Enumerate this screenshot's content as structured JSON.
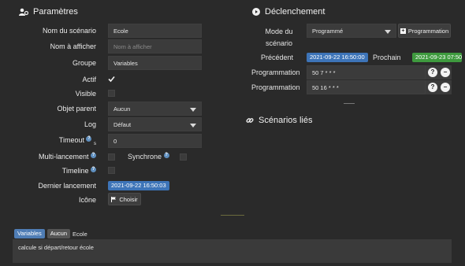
{
  "parametres": {
    "title": "Paramètres",
    "labels": {
      "nom_scenario": "Nom du scénario",
      "nom_afficher": "Nom à afficher",
      "groupe": "Groupe",
      "actif": "Actif",
      "visible": "Visible",
      "objet_parent": "Objet parent",
      "log": "Log",
      "timeout": "Timeout",
      "timeout_suffix": "s",
      "multi_lancement": "Multi-lancement",
      "synchrone": "Synchrone",
      "timeline": "Timeline",
      "dernier_lancement": "Dernier lancement",
      "icone": "Icône"
    },
    "values": {
      "nom_scenario": "Ecole",
      "nom_afficher_placeholder": "Nom à afficher",
      "groupe": "Variables",
      "objet_parent": "Aucun",
      "log": "Défaut",
      "timeout": "0",
      "dernier_lancement": "2021-09-22 16:50:03",
      "choisir": "Choisir"
    },
    "actif_checked": true,
    "visible_checked": false,
    "multi_lancement_checked": false,
    "synchrone_checked": false,
    "timeline_checked": false
  },
  "declenchement": {
    "title": "Déclenchement",
    "mode_label_1": "Mode du",
    "mode_label_2": "scénario",
    "mode_value": "Programmé",
    "programmation_button": "Programmation",
    "precedent_label": "Précédent",
    "precedent_value": "2021-09-22 16:50:00",
    "prochain_label": "Prochain",
    "prochain_value": "2021-09-23 07:50",
    "programmations": [
      {
        "label": "Programmation",
        "value": "50 7 * * *"
      },
      {
        "label": "Programmation",
        "value": "50 16 * * *"
      }
    ]
  },
  "scenarios_lies": {
    "title": "Scénarios liés"
  },
  "footer": {
    "tags": [
      "Variables",
      "Aucun"
    ],
    "name": "Ecole",
    "description": "calcule si départ/retour école"
  },
  "colors": {
    "badge_blue": "#3d74b8",
    "badge_green": "#3e9a3e",
    "tag_blue": "#4f7db5",
    "tag_gray": "#555555"
  }
}
